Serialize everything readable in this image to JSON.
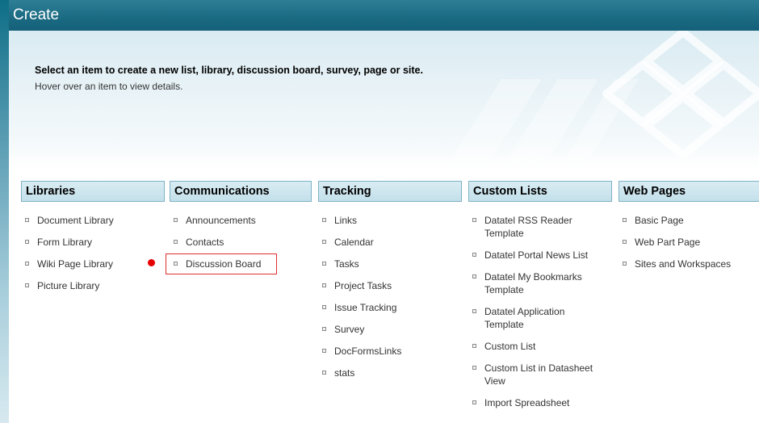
{
  "window": {
    "title": "Create"
  },
  "banner": {
    "heading": "Select an item to create a new list, library, discussion board, survey, page or site.",
    "subtext": "Hover over an item to view details."
  },
  "columns": [
    {
      "header": "Libraries",
      "items": [
        "Document Library",
        "Form Library",
        "Wiki Page Library",
        "Picture Library"
      ]
    },
    {
      "header": "Communications",
      "items": [
        "Announcements",
        "Contacts",
        "Discussion Board"
      ]
    },
    {
      "header": "Tracking",
      "items": [
        "Links",
        "Calendar",
        "Tasks",
        "Project Tasks",
        "Issue Tracking",
        "Survey",
        "DocFormsLinks",
        "stats"
      ]
    },
    {
      "header": "Custom Lists",
      "items": [
        "Datatel RSS Reader Template",
        "Datatel Portal News List",
        "Datatel My Bookmarks Template",
        "Datatel Application Template",
        "Custom List",
        "Custom List in Datasheet View",
        "Import Spreadsheet"
      ]
    },
    {
      "header": "Web Pages",
      "items": [
        "Basic Page",
        "Web Part Page",
        "Sites and Workspaces"
      ]
    }
  ],
  "colors": {
    "title_bar": "#1a6a82",
    "header_bg": "#c3e0ea",
    "header_border": "#7fb2c6",
    "highlight": "#e03030",
    "marker": "#e60000"
  }
}
